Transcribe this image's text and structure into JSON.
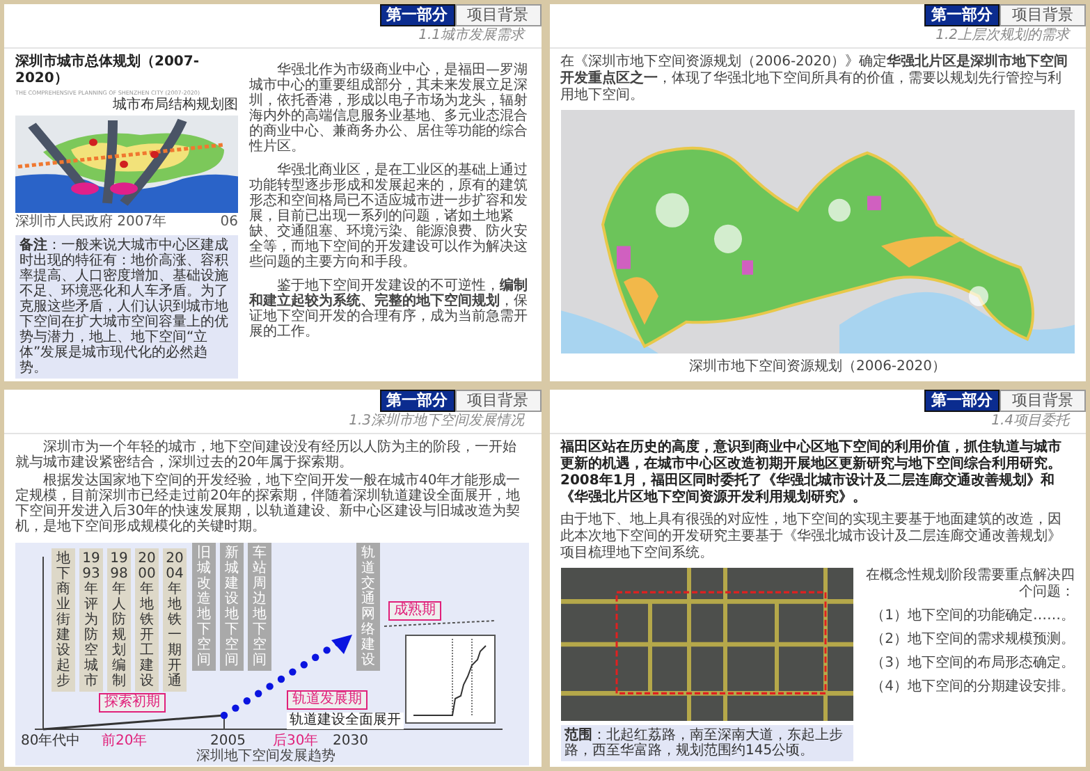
{
  "slides": [
    {
      "kind": "plan-map",
      "section_tag": "第一部分",
      "section_title": "项目背景",
      "subtitle": "1.1城市发展需求",
      "map_title": "深圳市城市总体规划（2007-2020）",
      "map_title_en": "THE COMPREHENSIVE PLANNING OF SHENZHEN CITY (2007-2020)",
      "map_label": "城市布局结构规划图",
      "map_source": "深圳市人民政府 2007年",
      "page_number": "06",
      "paragraphs": [
        "华强北作为市级商业中心，是福田—罗湖城市中心的重要组成部分，其未来发展立足深圳，依托香港，形成以电子市场为龙头，辐射海内外的高端信息服务业基地、多元业态混合的商业中心、兼商务办公、居住等功能的综合性片区。",
        "华强北商业区，是在工业区的基础上通过功能转型逐步形成和发展起来的，原有的建筑形态和空间格局已不适应城市进一步扩容和发展，目前已出现一系列的问题，诸如土地紧缺、交通阻塞、环境污染、能源浪费、防火安全等，而地下空间的开发建设可以作为解决这些问题的主要方向和手段。",
        "鉴于地下空间开发建设的不可逆性，**编制和建立起较为系统、完整的地下空间规划**，保证地下空间开发的合理有序，成为当前急需开展的工作。"
      ],
      "note": "**备注**：一般来说大城市中心区建成时出现的特征有：地价高涨、容积率提高、人口密度增加、基础设施不足、环境恶化和人车矛盾。为了克服这些矛盾，人们认识到城市地下空间在扩大城市空间容量上的优势与潜力，地上、地下空间“立体”发展是城市现代化的必然趋势。"
    },
    {
      "kind": "resource-map",
      "section_tag": "第一部分",
      "section_title": "项目背景",
      "subtitle": "1.2上层次规划的需求",
      "intro": "在《深圳市地下空间资源规划（2006-2020）》确定**华强北片区是深圳市地下空间开发重点区之一**，体现了华强北地下空间所具有的价值，需要以规划先行管控与利用地下空间。",
      "caption": "深圳市地下空间资源规划（2006-2020）"
    },
    {
      "kind": "timeline",
      "section_tag": "第一部分",
      "section_title": "项目背景",
      "subtitle": "1.3深圳市地下空间发展情况",
      "paragraphs": [
        "深圳市为一个年轻的城市，地下空间建设没有经历以人防为主的阶段，一开始就与城市建设紧密结合，深圳过去的20年属于探索期。",
        "根据发达国家地下空间的开发经验，地下空间开发一般在城市40年才能形成一定规模，目前深圳市已经走过前20年的探索期，伴随着深圳轨道建设全面展开，地下空间开发进入后30年的快速发展期，以轨道建设、新中心区建设与旧城改造为契机，是地下空间形成规模化的关键时期。"
      ],
      "chart": {
        "events": [
          {
            "kind": "milestone",
            "text": "地下商业街建设起步"
          },
          {
            "kind": "milestone",
            "text": "1993年评为防空城市"
          },
          {
            "kind": "milestone",
            "text": "1998年人防规划编制"
          },
          {
            "kind": "milestone",
            "text": "2000年地铁开工建设"
          },
          {
            "kind": "milestone",
            "text": "2004年地铁一期开通"
          },
          {
            "kind": "phase",
            "text": "旧城改造地下空间"
          },
          {
            "kind": "phase",
            "text": "新城建设地下空间"
          },
          {
            "kind": "phase",
            "text": "车站周边地下空间"
          },
          {
            "kind": "phase",
            "text": "轨道交通网络建设"
          }
        ],
        "labels": [
          {
            "kind": "stage",
            "text": "探索初期"
          },
          {
            "kind": "stage",
            "text": "轨道发展期"
          },
          {
            "kind": "plain",
            "text": "轨道建设全面展开"
          },
          {
            "kind": "stage",
            "text": "成熟期"
          }
        ],
        "axis_labels": [
          {
            "kind": "tick",
            "text": "80年代中"
          },
          {
            "kind": "period",
            "text": "前20年"
          },
          {
            "kind": "tick",
            "text": "2005"
          },
          {
            "kind": "period",
            "text": "后30年"
          },
          {
            "kind": "tick",
            "text": "2030"
          }
        ],
        "caption": "深圳地下空间发展趋势"
      }
    },
    {
      "kind": "commission",
      "section_tag": "第一部分",
      "section_title": "项目背景",
      "subtitle": "1.4项目委托",
      "paragraphs": [
        {
          "text": "福田区站在历史的高度，意识到商业中心区地下空间的利用价值，抓住轨道与城市更新的机遇，在城市中心区改造初期开展地区更新研究与地下空间综合利用研究。2008年1月，福田区同时委托了《华强北城市设计及二层连廊交通改善规划》和《华强北片区地下空间资源开发利用规划研究》。",
          "bold": true
        },
        {
          "text": "由于地下、地上具有很强的对应性，地下空间的实现主要基于地面建筑的改造，因此本次地下空间的开发研究主要基于《华强北城市设计及二层连廊交通改善规划》项目梳理地下空间系统。",
          "bold": false
        }
      ],
      "questions_intro": "在概念性规划阶段需要重点解决四个问题：",
      "questions": [
        "（1）地下空间的功能确定……。",
        "（2）地下空间的需求规模预测。",
        "（3）地下空间的布局形态确定。",
        "（4）地下空间的分期建设安排。"
      ],
      "scope": "**范围**：北起红荔路，南至深南大道，东起上步路，西至华富路，规划范围约145公顷。"
    }
  ]
}
